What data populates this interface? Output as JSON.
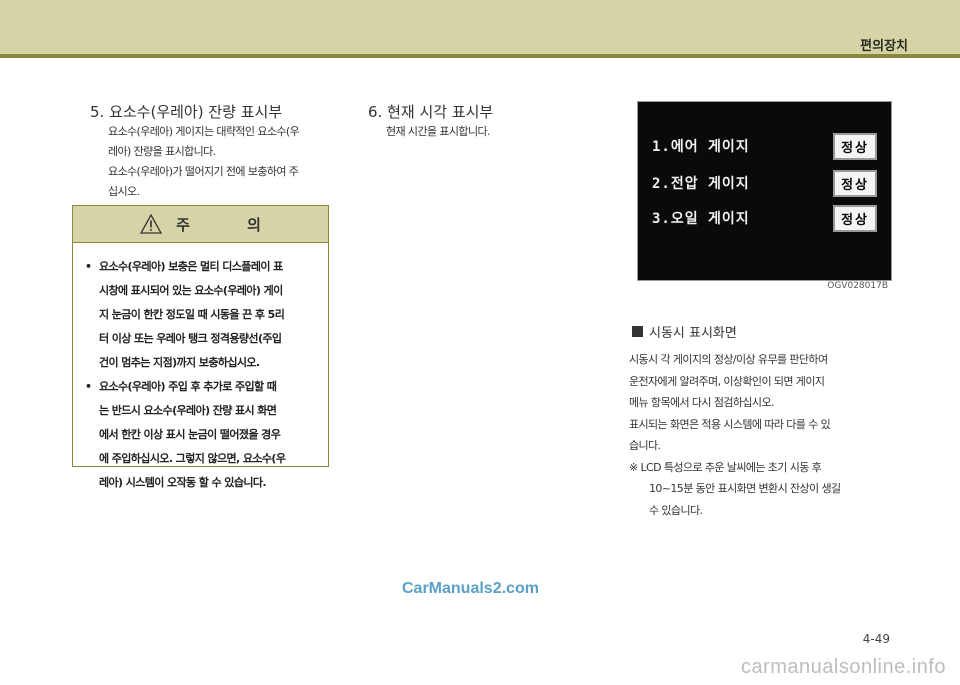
{
  "header": {
    "title": "편의장치"
  },
  "section5": {
    "title": "5. 요소수(우레아) 잔량 표시부",
    "lines": [
      "요소수(우레아) 게이지는 대략적인 요소수(우",
      "레아) 잔량을 표시합니다.",
      "요소수(우레아)가 떨어지기 전에 보충하여 주",
      "십시오."
    ]
  },
  "caution": {
    "title": "주 의",
    "icon": "warning-triangle-icon",
    "items": [
      {
        "lines": [
          "요소수(우레아) 보충은 멀티 디스플레이 표",
          "시창에 표시되어 있는 요소수(우레아) 게이",
          "지 눈금이 한칸 정도일 때 시동을 끈 후 5리",
          "터 이상 또는 우레아 탱크 정격용량선(주입",
          "건이 멈추는 지점)까지 보충하십시오."
        ]
      },
      {
        "lines": [
          "요소수(우레아) 주입 후 추가로 주입할 때",
          "는 반드시 요소수(우레아) 잔량 표시 화면",
          "에서 한칸 이상 표시 눈금이 떨어졌을 경우",
          "에 주입하십시오. 그렇지 않으면, 요소수(우",
          "레아) 시스템이 오작동 할 수 있습니다."
        ]
      }
    ]
  },
  "section6": {
    "title": "6. 현재 시각 표시부",
    "lines": [
      "현재 시간을 표시합니다."
    ]
  },
  "screen": {
    "rows": [
      {
        "label": "1.에어 게이지",
        "status": "정상"
      },
      {
        "label": "2.전압 게이지",
        "status": "정상"
      },
      {
        "label": "3.오일 게이지",
        "status": "정상"
      }
    ],
    "figure_code": "OGV028017B"
  },
  "boot_screen": {
    "heading": "시동시 표시화면",
    "lines": [
      "시동시 각 게이지의 정상/이상 유무를 판단하여",
      "운전자에게 알려주며, 이상확인이 되면 게이지",
      "메뉴 항목에서 다시 점검하십시오.",
      "표시되는 화면은 적용 시스템에 따라 다를 수 있",
      "습니다."
    ],
    "note_lines": [
      "※ LCD 특성으로 추운 날씨에는 초기 시동 후",
      "10~15분 동안 표시화면 변환시 잔상이 생길",
      "수 있습니다."
    ]
  },
  "watermark": "CarManuals2.com",
  "page_number": "4-49",
  "footer": "carmanualsonline.info",
  "colors": {
    "band": "#d6d4a6",
    "rule": "#8b8a3c",
    "screen_bg": "#0c0a08"
  }
}
